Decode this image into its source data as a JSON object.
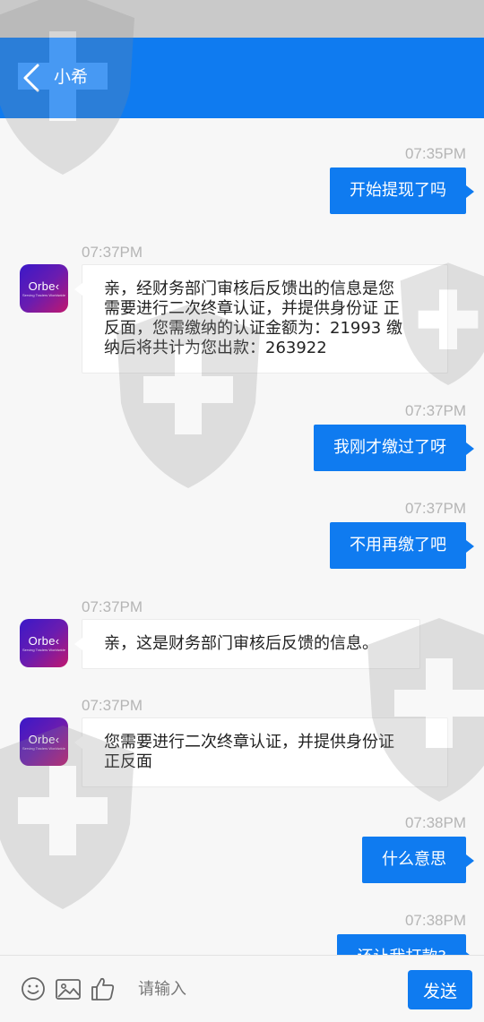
{
  "header": {
    "title": "小希"
  },
  "avatar": {
    "logo": "Orbe‹",
    "tagline": "Serving Traders Worldwide"
  },
  "messages": [
    {
      "time": "07:35PM",
      "text": "开始提现了吗"
    },
    {
      "time": "07:37PM",
      "line1": "亲，经财务部门审核后反馈出的信息是您",
      "line2": "需要进行二次终章认证，并提供身份证 正",
      "line3": "反面，您需缴纳的认证金额为：21993 缴",
      "line4": "纳后将共计为您出款：263922"
    },
    {
      "time": "07:37PM",
      "text": "我刚才缴过了呀"
    },
    {
      "time": "07:37PM",
      "text": "不用再缴了吧"
    },
    {
      "time": "07:37PM",
      "text": "亲，这是财务部门审核后反馈的信息。"
    },
    {
      "time": "07:37PM",
      "line1": "您需要进行二次终章认证，并提供身份证",
      "line2": "正反面"
    },
    {
      "time": "07:38PM",
      "text": "什么意思"
    },
    {
      "time": "07:38PM",
      "text": "还让我打款?"
    }
  ],
  "input": {
    "placeholder": "请输入"
  },
  "send": {
    "label": "发送"
  },
  "icons": {
    "back": "chevron-left-icon",
    "emoji": "smiley-icon",
    "image": "image-icon",
    "like": "thumbs-up-icon"
  },
  "colors": {
    "accent": "#0f7bf0",
    "background": "#f7f7f7"
  }
}
